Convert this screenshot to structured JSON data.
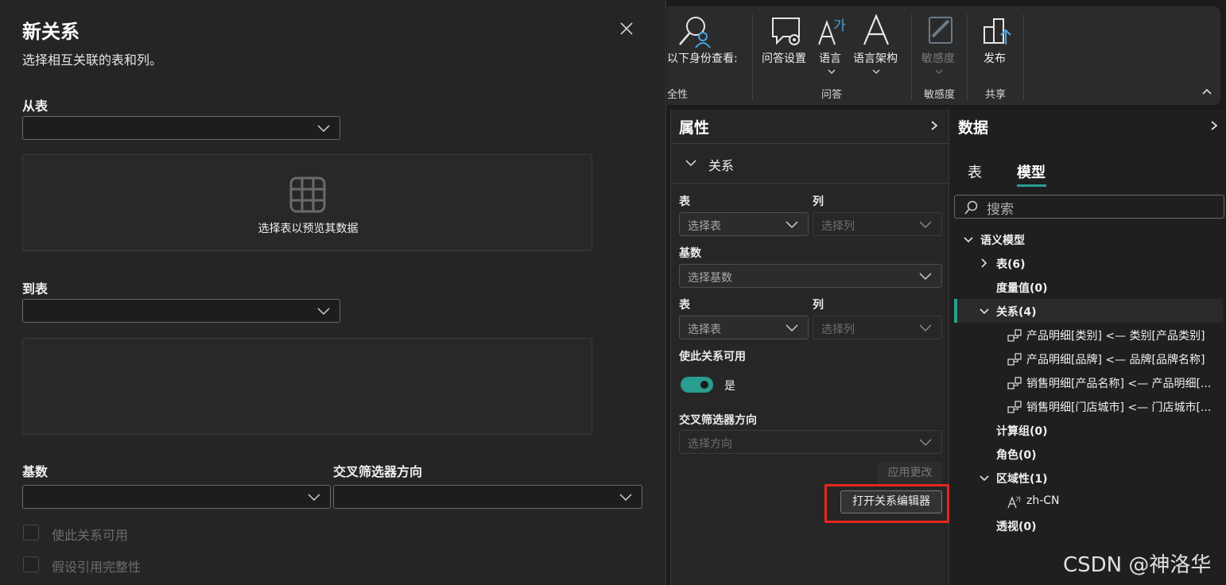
{
  "dialog": {
    "title": "新关系",
    "subtitle": "选择相互关联的表和列。",
    "from_table_label": "从表",
    "preview_text": "选择表以预览其数据",
    "to_table_label": "到表",
    "cardinality_label": "基数",
    "cross_filter_label": "交叉筛选器方向",
    "make_active_label": "使此关系可用",
    "assume_integrity_label": "假设引用完整性"
  },
  "ribbon": {
    "view_as_label": "以下身份查看:",
    "security_group_partial": "全性",
    "qa_setup_label": "问答设置",
    "language_label": "语言",
    "linguistic_schema_label": "语言架构",
    "qa_group": "问答",
    "sensitivity_label": "敏感度",
    "sensitivity_group": "敏感度",
    "publish_label": "发布",
    "share_group": "共享"
  },
  "properties": {
    "title": "属性",
    "section": "关系",
    "table_label_1": "表",
    "column_label_1": "列",
    "table_placeholder_1": "选择表",
    "column_placeholder_1": "选择列",
    "cardinality_label": "基数",
    "cardinality_placeholder": "选择基数",
    "table_label_2": "表",
    "column_label_2": "列",
    "table_placeholder_2": "选择表",
    "column_placeholder_2": "选择列",
    "make_active_label": "使此关系可用",
    "toggle_value": "是",
    "toggle_on": true,
    "cross_filter_label": "交叉筛选器方向",
    "cross_filter_placeholder": "选择方向",
    "apply_button": "应用更改",
    "open_editor_button": "打开关系编辑器"
  },
  "data_pane": {
    "title": "数据",
    "tabs": [
      "表",
      "模型"
    ],
    "active_tab": "模型",
    "search_placeholder": "搜索",
    "tree": {
      "root": "语义模型",
      "tables": "表(6)",
      "measures": "度量值(0)",
      "relationships": "关系(4)",
      "relationship_items": [
        "产品明细[类别] <— 类别[产品类别]",
        "产品明细[品牌] <— 品牌[品牌名称]",
        "销售明细[产品名称] <— 产品明细[...",
        "销售明细[门店城市] <— 门店城市[..."
      ],
      "calc_groups": "计算组(0)",
      "roles": "角色(0)",
      "cultures": "区域性(1)",
      "culture_item": "zh-CN",
      "perspectives": "透视(0)"
    }
  },
  "watermark": "CSDN @神洛华",
  "colors": {
    "accent": "#2a9d8f",
    "highlight": "#e8261c"
  }
}
